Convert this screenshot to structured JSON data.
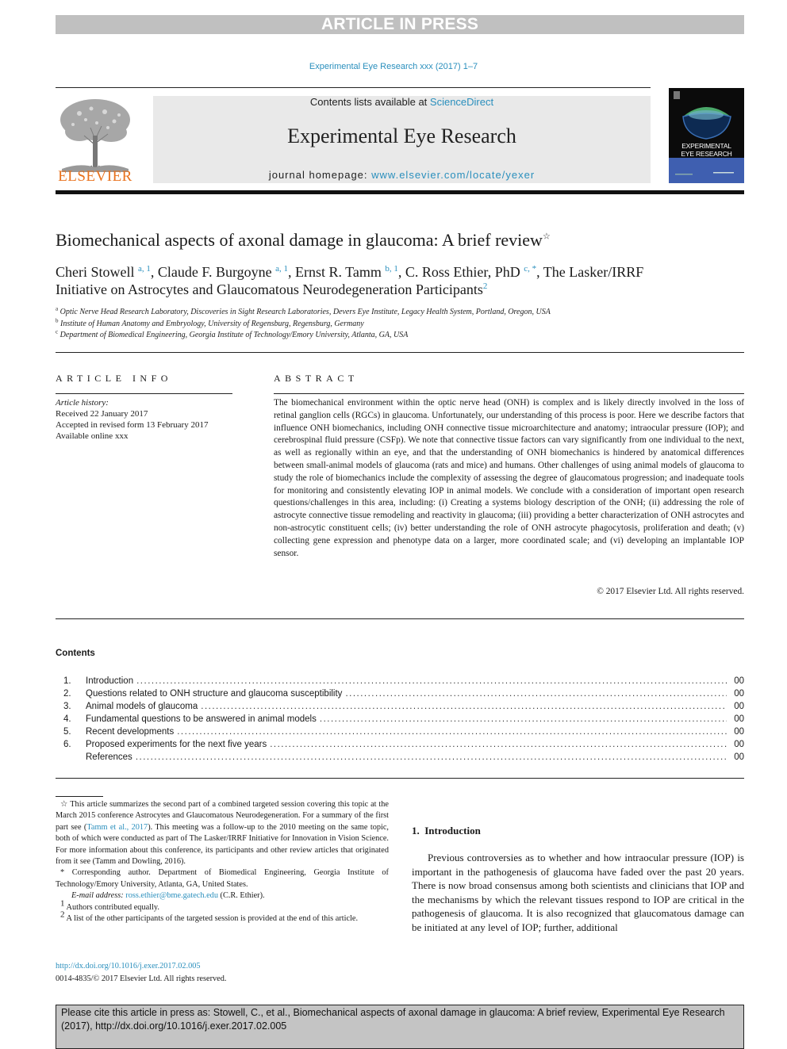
{
  "banner": "ARTICLE IN PRESS",
  "running_head": "Experimental Eye Research xxx (2017) 1–7",
  "journal_header": {
    "publisher_logo": "ELSEVIER",
    "contents_prefix": "Contents lists available at ",
    "contents_link": "ScienceDirect",
    "journal_name": "Experimental Eye Research",
    "homepage_prefix": "journal homepage: ",
    "homepage_link": "www.elsevier.com/locate/yexer",
    "cover_title_line1": "EXPERIMENTAL",
    "cover_title_line2": "EYE RESEARCH"
  },
  "article": {
    "title": "Biomechanical aspects of axonal damage in glaucoma: A brief review",
    "title_mark": "☆",
    "authors": [
      {
        "name": "Cheri Stowell",
        "sup": "a, 1",
        "sep": ", "
      },
      {
        "name": "Claude F. Burgoyne",
        "sup": "a, 1",
        "sep": ", "
      },
      {
        "name": "Ernst R. Tamm",
        "sup": "b, 1",
        "sep": ", "
      },
      {
        "name": "C. Ross Ethier, PhD",
        "sup": "c, *",
        "sep": ", "
      },
      {
        "name": "The Lasker/IRRF Initiative on Astrocytes and Glaucomatous Neurodegeneration Participants",
        "sup": "2",
        "sep": ""
      }
    ],
    "affiliations": [
      {
        "key": "a",
        "text": "Optic Nerve Head Research Laboratory, Discoveries in Sight Research Laboratories, Devers Eye Institute, Legacy Health System, Portland, Oregon, USA"
      },
      {
        "key": "b",
        "text": "Institute of Human Anatomy and Embryology, University of Regensburg, Regensburg, Germany"
      },
      {
        "key": "c",
        "text": "Department of Biomedical Engineering, Georgia Institute of Technology/Emory University, Atlanta, GA, USA"
      }
    ]
  },
  "article_info": {
    "label": "ARTICLE INFO",
    "history_label": "Article history:",
    "received": "Received 22 January 2017",
    "accepted": "Accepted in revised form 13 February 2017",
    "online": "Available online xxx"
  },
  "abstract": {
    "label": "ABSTRACT",
    "text": "The biomechanical environment within the optic nerve head (ONH) is complex and is likely directly involved in the loss of retinal ganglion cells (RGCs) in glaucoma. Unfortunately, our understanding of this process is poor. Here we describe factors that influence ONH biomechanics, including ONH connective tissue microarchitecture and anatomy; intraocular pressure (IOP); and cerebrospinal fluid pressure (CSFp). We note that connective tissue factors can vary significantly from one individual to the next, as well as regionally within an eye, and that the understanding of ONH biomechanics is hindered by anatomical differences between small-animal models of glaucoma (rats and mice) and humans. Other challenges of using animal models of glaucoma to study the role of biomechanics include the complexity of assessing the degree of glaucomatous progression; and inadequate tools for monitoring and consistently elevating IOP in animal models. We conclude with a consideration of important open research questions/challenges in this area, including: (i) Creating a systems biology description of the ONH; (ii) addressing the role of astrocyte connective tissue remodeling and reactivity in glaucoma; (iii) providing a better characterization of ONH astrocytes and non-astrocytic constituent cells; (iv) better understanding the role of ONH astrocyte phagocytosis, proliferation and death; (v) collecting gene expression and phenotype data on a larger, more coordinated scale; and (vi) developing an implantable IOP sensor.",
    "copyright": "© 2017 Elsevier Ltd. All rights reserved."
  },
  "contents": {
    "title": "Contents",
    "items": [
      {
        "num": "1.",
        "label": "Introduction",
        "page": "00"
      },
      {
        "num": "2.",
        "label": "Questions related to ONH structure and glaucoma susceptibility",
        "page": "00"
      },
      {
        "num": "3.",
        "label": "Animal models of glaucoma",
        "page": "00"
      },
      {
        "num": "4.",
        "label": "Fundamental questions to be answered in animal models",
        "page": "00"
      },
      {
        "num": "5.",
        "label": "Recent developments",
        "page": "00"
      },
      {
        "num": "6.",
        "label": "Proposed experiments for the next five years",
        "page": "00"
      },
      {
        "num": "",
        "label": "References",
        "page": "00"
      }
    ]
  },
  "footnotes": {
    "star_pre": "☆ This article summarizes the second part of a combined targeted session covering this topic at the March 2015 conference Astrocytes and Glaucomatous Neurodegeneration. For a summary of the first part see (",
    "star_link": "Tamm et al., 2017",
    "star_post": "). This meeting was a follow-up to the 2010 meeting on the same topic, both of which were conducted as part of The Lasker/IRRF Initiative for Innovation in Vision Science. For more information about this conference, its participants and other review articles that originated from it see (Tamm and Dowling, 2016).",
    "corresponding": "* Corresponding author. Department of Biomedical Engineering, Georgia Institute of Technology/Emory University, Atlanta, GA, United States.",
    "email_label": "E-mail address: ",
    "email": "ross.ethier@bme.gatech.edu",
    "email_suffix": " (C.R. Ethier).",
    "fn1_mark": "1",
    "fn1": "Authors contributed equally.",
    "fn2_mark": "2",
    "fn2": "A list of the other participants of the targeted session is provided at the end of this article.",
    "doi": "http://dx.doi.org/10.1016/j.exer.2017.02.005",
    "issn": "0014-4835/© 2017 Elsevier Ltd. All rights reserved."
  },
  "introduction": {
    "heading": "1.  Introduction",
    "text": "Previous controversies as to whether and how intraocular pressure (IOP) is important in the pathogenesis of glaucoma have faded over the past 20 years. There is now broad consensus among both scientists and clinicians that IOP and the mechanisms by which the relevant tissues respond to IOP are critical in the pathogenesis of glaucoma. It is also recognized that glaucomatous damage can be initiated at any level of IOP; further, additional"
  },
  "citation_box": "Please cite this article in press as: Stowell, C., et al., Biomechanical aspects of axonal damage in glaucoma: A brief review, Experimental Eye Research (2017), http://dx.doi.org/10.1016/j.exer.2017.02.005",
  "colors": {
    "link": "#2a8fbd",
    "banner": "#c0c0c0",
    "journal_box": "#e9e9e9",
    "publisher_orange": "#e9711c"
  }
}
